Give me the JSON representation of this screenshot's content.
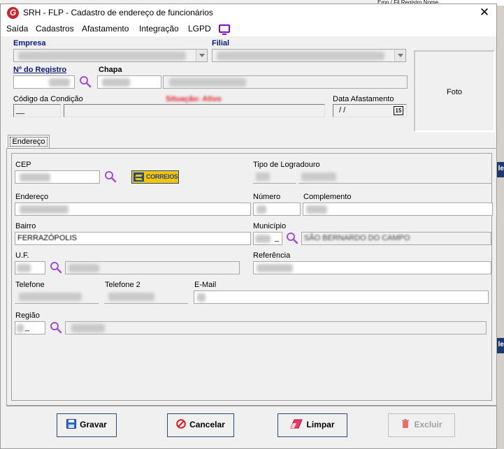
{
  "background": {
    "top_text": "Emp / Fil   Registro   Nome",
    "tab_text": "le"
  },
  "window": {
    "title": "SRH - FLP - Cadastro de endereço de funcionários",
    "logo_letter": "G",
    "close": "✕"
  },
  "menu": {
    "items": [
      "Saída",
      "Cadastros",
      "Afastamento",
      "Integração",
      "LGPD"
    ]
  },
  "header": {
    "empresa_label": "Empresa",
    "filial_label": "Filial",
    "registro_label": "Nº do Registro",
    "chapa_label": "Chapa",
    "codigo_condicao_label": "Código da Condição",
    "codigo_condicao_value": "__",
    "situacao_label": "Situação: Ativo",
    "data_afastamento_label": "Data Afastamento",
    "data_afastamento_value": "/ /",
    "calendar_day": "15",
    "foto_label": "Foto"
  },
  "tab": {
    "label": "Endereço"
  },
  "endereco": {
    "cep_label": "CEP",
    "correios_label": "CORREIOS",
    "tipo_logradouro_label": "Tipo de Logradouro",
    "endereco_label": "Endereço",
    "numero_label": "Número",
    "complemento_label": "Complemento",
    "bairro_label": "Bairro",
    "bairro_value": "FERRAZÓPOLIS",
    "municipio_label": "Município",
    "municipio_code": "_",
    "municipio_name": "SÃO BERNARDO DO CAMPO",
    "uf_label": "U.F.",
    "referencia_label": "Referência",
    "telefone_label": "Telefone",
    "telefone2_label": "Telefone 2",
    "email_label": "E-Mail",
    "regiao_label": "Região",
    "regiao_value": "_"
  },
  "buttons": {
    "gravar": "Gravar",
    "cancelar": "Cancelar",
    "limpar": "Limpar",
    "excluir": "Excluir"
  },
  "colors": {
    "label_blue": "#0a1a7a",
    "status_red": "#e0202a",
    "search_purple": "#a24fd1",
    "button_border": "#2b4a7a"
  }
}
